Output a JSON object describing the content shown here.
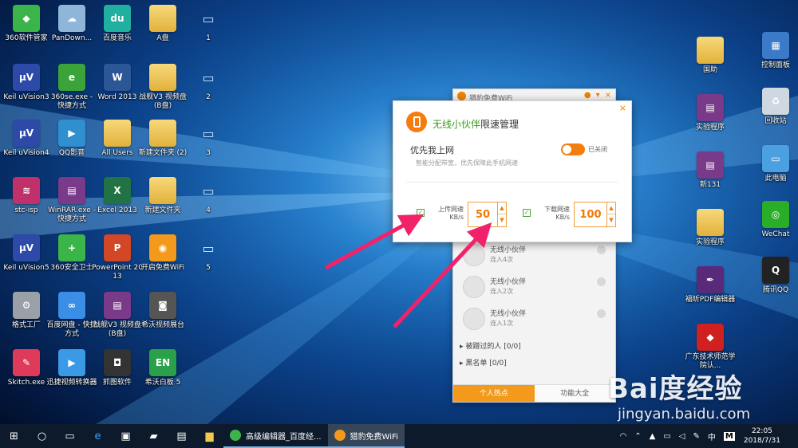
{
  "desktop": {
    "icons": [
      {
        "label": "360软件管家",
        "icon": "360-softmgr-icon",
        "color": "#3bb54a",
        "glyph": "◆"
      },
      {
        "label": "PanDown...",
        "icon": "cloud-icon",
        "color": "#8fb6d9",
        "glyph": "☁"
      },
      {
        "label": "百度音乐",
        "icon": "baidu-music-icon",
        "color": "#20b0a0",
        "glyph": "du"
      },
      {
        "label": "A盘",
        "icon": "folder-icon",
        "color": "#e2b13c",
        "glyph": ""
      },
      {
        "label": "1",
        "icon": "network-file-icon",
        "color": "",
        "glyph": "▭"
      },
      {
        "label": "Keil uVision3",
        "icon": "keil-icon",
        "color": "#2d4aa8",
        "glyph": "μV"
      },
      {
        "label": "360se.exe - 快捷方式",
        "icon": "360se-icon",
        "color": "#3aa43a",
        "glyph": "e"
      },
      {
        "label": "Word 2013",
        "icon": "word-icon",
        "color": "#2b5797",
        "glyph": "W"
      },
      {
        "label": "战舰V3 视频盘(B盘)",
        "icon": "folder-icon",
        "color": "#e2b13c",
        "glyph": ""
      },
      {
        "label": "2",
        "icon": "network-file-icon",
        "color": "",
        "glyph": "▭"
      },
      {
        "label": "Keil uVision4",
        "icon": "keil-icon",
        "color": "#2d4aa8",
        "glyph": "μV"
      },
      {
        "label": "QQ影音",
        "icon": "qq-player-icon",
        "color": "#2f8fcf",
        "glyph": "▶"
      },
      {
        "label": "All Users",
        "icon": "folder-icon",
        "color": "#e2b13c",
        "glyph": ""
      },
      {
        "label": "新建文件夹 (2)",
        "icon": "folder-icon",
        "color": "#e2b13c",
        "glyph": ""
      },
      {
        "label": "3",
        "icon": "network-file-icon",
        "color": "",
        "glyph": "▭"
      },
      {
        "label": "stc-isp",
        "icon": "stc-isp-icon",
        "color": "#c0306a",
        "glyph": "≋"
      },
      {
        "label": "WinRAR.exe - 快捷方式",
        "icon": "winrar-icon",
        "color": "#7a3a8a",
        "glyph": "▤"
      },
      {
        "label": "Excel 2013",
        "icon": "excel-icon",
        "color": "#217346",
        "glyph": "X"
      },
      {
        "label": "新建文件夹",
        "icon": "folder-icon",
        "color": "#e2b13c",
        "glyph": ""
      },
      {
        "label": "4",
        "icon": "network-file-icon",
        "color": "",
        "glyph": "▭"
      },
      {
        "label": "Keil uVision5",
        "icon": "keil-icon",
        "color": "#2d4aa8",
        "glyph": "μV"
      },
      {
        "label": "360安全卫士",
        "icon": "360-safe-icon",
        "color": "#3bb54a",
        "glyph": "+"
      },
      {
        "label": "PowerPoint 2013",
        "icon": "powerpoint-icon",
        "color": "#d24726",
        "glyph": "P"
      },
      {
        "label": "开启免费WiFi",
        "icon": "wifi-icon",
        "color": "#f39a1c",
        "glyph": "◉"
      },
      {
        "label": "5",
        "icon": "network-file-icon",
        "color": "",
        "glyph": "▭"
      },
      {
        "label": "格式工厂",
        "icon": "format-factory-icon",
        "color": "#9aa0a8",
        "glyph": "⚙"
      },
      {
        "label": "百度网盘 - 快捷方式",
        "icon": "baidu-netdisk-icon",
        "color": "#3a8ee6",
        "glyph": "∞"
      },
      {
        "label": "战舰V3 视频盘(B盘)",
        "icon": "winrar-icon",
        "color": "#7a3a8a",
        "glyph": "▤"
      },
      {
        "label": "希沃视频展台",
        "icon": "camera-icon",
        "color": "#555",
        "glyph": "◙"
      },
      {
        "label": "Skitch.exe",
        "icon": "skitch-icon",
        "color": "#e03a5a",
        "glyph": "✎"
      },
      {
        "label": "迅捷视频转换器",
        "icon": "video-converter-icon",
        "color": "#3a9ae6",
        "glyph": "▶"
      },
      {
        "label": "抓图软件",
        "icon": "capture-icon",
        "color": "#333",
        "glyph": "◘"
      },
      {
        "label": "希沃白板 5",
        "icon": "whiteboard-icon",
        "color": "#2aa04a",
        "glyph": "EN"
      },
      {
        "label": "国助",
        "icon": "file-icon",
        "color": "#e2b13c",
        "glyph": ""
      },
      {
        "label": "实验程序",
        "icon": "winrar-icon",
        "color": "#7a3a8a",
        "glyph": "▤"
      },
      {
        "label": "新131",
        "icon": "winrar-icon",
        "color": "#7a3a8a",
        "glyph": "▤"
      },
      {
        "label": "实验程序",
        "icon": "folder-icon",
        "color": "#e2b13c",
        "glyph": ""
      },
      {
        "label": "福昕PDF编辑器",
        "icon": "pdf-editor-icon",
        "color": "#5a2a7a",
        "glyph": "✒"
      },
      {
        "label": "广东技术师范学院认...",
        "icon": "auth-icon",
        "color": "#d02020",
        "glyph": "◆"
      },
      {
        "label": "控制面板",
        "icon": "control-panel-icon",
        "color": "#3a7ac8",
        "glyph": "▦"
      },
      {
        "label": "回收站",
        "icon": "recycle-bin-icon",
        "color": "#cfd8e0",
        "glyph": "♻"
      },
      {
        "label": "此电脑",
        "icon": "computer-icon",
        "color": "#4aa0e0",
        "glyph": "▭"
      },
      {
        "label": "WeChat",
        "icon": "wechat-icon",
        "color": "#2aae2a",
        "glyph": "◎"
      },
      {
        "label": "腾讯QQ",
        "icon": "qq-icon",
        "color": "#222",
        "glyph": "Q"
      }
    ]
  },
  "wifi_panel": {
    "title": "猎豹免费WiFi",
    "items": [
      {
        "name": "无线小伙伴",
        "count": "连入4次"
      },
      {
        "name": "无线小伙伴",
        "count": "连入2次"
      },
      {
        "name": "无线小伙伴",
        "count": "连入1次"
      }
    ],
    "kicked": "被蹭过的人  [0/0]",
    "blacklist": "黑名单  [0/0]",
    "tabs": [
      "个人热点",
      "功能大全"
    ]
  },
  "dialog": {
    "title_highlight": "无线小伙伴",
    "title_rest": "限速管理",
    "priority_label": "优先我上网",
    "priority_desc": "智能分配带宽，优先保障此手机网速",
    "toggle_label": "已关闭",
    "upload": {
      "label_line1": "上传网速",
      "label_line2": "KB/s",
      "value": "50"
    },
    "download": {
      "label_line1": "下载网速",
      "label_line2": "KB/s",
      "value": "100"
    },
    "close": "×"
  },
  "taskbar": {
    "apps": [
      {
        "label": "高级编辑器_百度经..."
      },
      {
        "label": "猎豹免费WiFi"
      }
    ],
    "tray": {
      "ime": "中",
      "m": "M",
      "time": "22:05",
      "date": "2018/7/31"
    }
  },
  "watermark": {
    "brand": "Bai度经验",
    "url": "jingyan.baidu.com"
  }
}
